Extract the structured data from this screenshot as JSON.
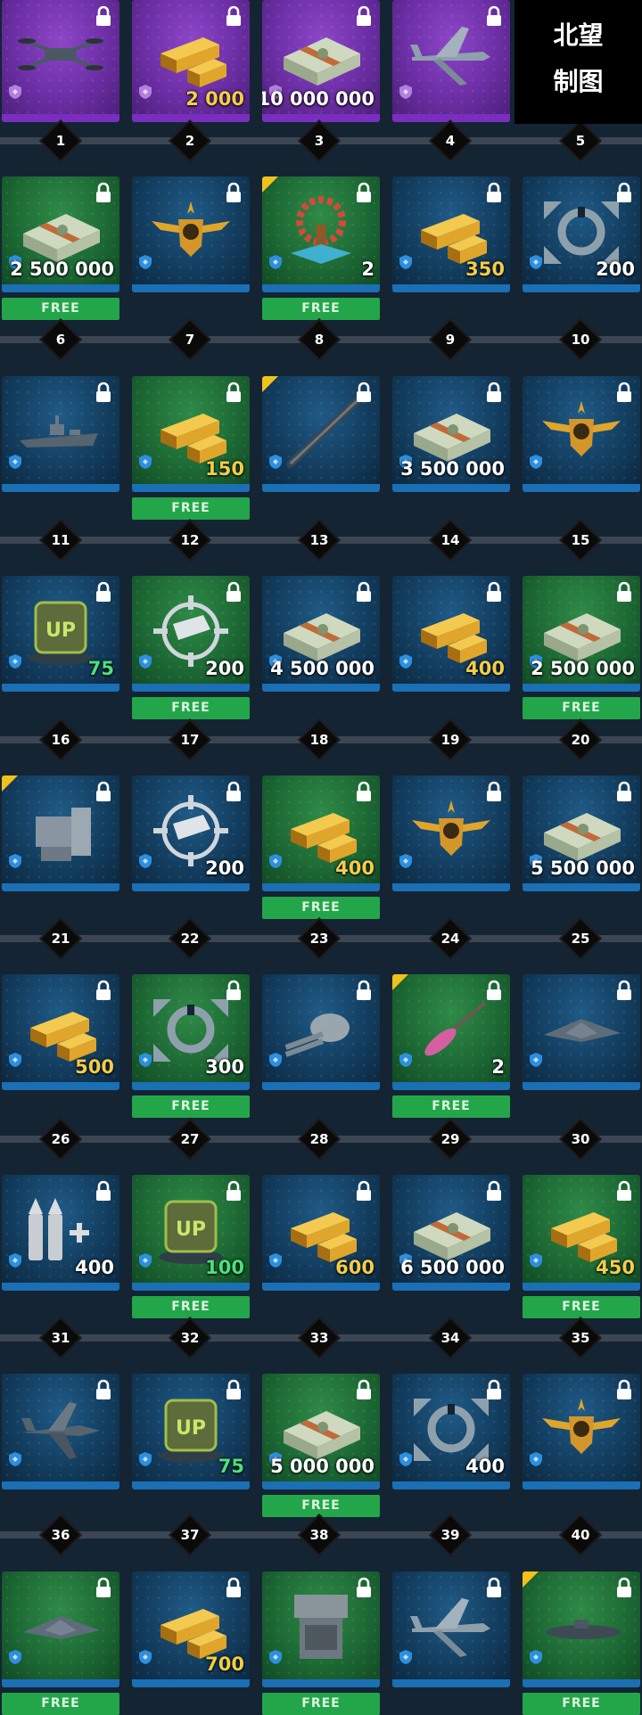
{
  "watermark": {
    "line1": "北望",
    "line2": "制图"
  },
  "colors": {
    "gold": "#f1cd4a",
    "free": "#23a64a",
    "blue_bar": "#1a6fb5",
    "premium": "#8c46c8",
    "rare_corner": "#f2c21b"
  },
  "free_label": "FREE",
  "levels": [
    "1",
    "2",
    "3",
    "4",
    "5",
    "6",
    "7",
    "8",
    "9",
    "10",
    "11",
    "12",
    "13",
    "14",
    "15",
    "16",
    "17",
    "18",
    "19",
    "20",
    "21",
    "22",
    "23",
    "24",
    "25",
    "26",
    "27",
    "28",
    "29",
    "30",
    "31",
    "32",
    "33",
    "34",
    "35",
    "36",
    "37",
    "38",
    "39",
    "40"
  ],
  "rows": [
    {
      "tiles": [
        {
          "style": "purple",
          "icon": "drone-icon",
          "amount": "",
          "amount_color": "white",
          "free": false,
          "corner": false
        },
        {
          "style": "purple",
          "icon": "gold-bars-icon",
          "amount": "2 000",
          "amount_color": "gold",
          "free": false,
          "corner": false
        },
        {
          "style": "purple",
          "icon": "cash-stack-icon",
          "amount": "10 000 000",
          "amount_color": "white",
          "free": false,
          "corner": false
        },
        {
          "style": "purple",
          "icon": "attack-plane-icon",
          "amount": "",
          "amount_color": "white",
          "free": false,
          "corner": false
        }
      ]
    },
    {
      "tiles": [
        {
          "style": "green",
          "icon": "cash-stack-icon",
          "amount": "2 500 000",
          "amount_color": "white",
          "free": true,
          "corner": false
        },
        {
          "style": "blue",
          "icon": "winged-emblem-icon",
          "amount": "",
          "amount_color": "white",
          "free": false,
          "corner": false
        },
        {
          "style": "green",
          "icon": "decoration-arch-icon",
          "amount": "2",
          "amount_color": "white",
          "free": true,
          "corner": true
        },
        {
          "style": "blue",
          "icon": "gold-bars-icon",
          "amount": "350",
          "amount_color": "gold",
          "free": false,
          "corner": false
        },
        {
          "style": "blue",
          "icon": "repair-kit-icon",
          "amount": "200",
          "amount_color": "white",
          "free": false,
          "corner": false
        }
      ]
    },
    {
      "tiles": [
        {
          "style": "blue",
          "icon": "warship-icon",
          "amount": "",
          "amount_color": "white",
          "free": false,
          "corner": false
        },
        {
          "style": "green",
          "icon": "gold-bars-icon",
          "amount": "150",
          "amount_color": "gold",
          "free": true,
          "corner": false
        },
        {
          "style": "blue",
          "icon": "rocket-launcher-icon",
          "amount": "",
          "amount_color": "white",
          "free": false,
          "corner": true
        },
        {
          "style": "blue",
          "icon": "cash-stack-icon",
          "amount": "3 500 000",
          "amount_color": "white",
          "free": false,
          "corner": false
        },
        {
          "style": "blue",
          "icon": "winged-emblem-icon",
          "amount": "",
          "amount_color": "white",
          "free": false,
          "corner": false
        }
      ]
    },
    {
      "tiles": [
        {
          "style": "blue",
          "icon": "upgrade-crate-icon",
          "amount": "75",
          "amount_color": "green",
          "free": false,
          "corner": false
        },
        {
          "style": "green",
          "icon": "crosshair-shell-icon",
          "amount": "200",
          "amount_color": "white",
          "free": true,
          "corner": false
        },
        {
          "style": "blue",
          "icon": "cash-stack-icon",
          "amount": "4 500 000",
          "amount_color": "white",
          "free": false,
          "corner": false
        },
        {
          "style": "blue",
          "icon": "gold-bars-icon",
          "amount": "400",
          "amount_color": "gold",
          "free": false,
          "corner": false
        },
        {
          "style": "green",
          "icon": "cash-stack-icon",
          "amount": "2 500 000",
          "amount_color": "white",
          "free": true,
          "corner": false
        }
      ]
    },
    {
      "tiles": [
        {
          "style": "blue",
          "icon": "missile-turret-icon",
          "amount": "",
          "amount_color": "white",
          "free": false,
          "corner": true
        },
        {
          "style": "blue",
          "icon": "crosshair-shell-icon",
          "amount": "200",
          "amount_color": "white",
          "free": false,
          "corner": false
        },
        {
          "style": "green",
          "icon": "gold-bars-icon",
          "amount": "400",
          "amount_color": "gold",
          "free": true,
          "corner": false
        },
        {
          "style": "blue",
          "icon": "winged-emblem-icon",
          "amount": "",
          "amount_color": "white",
          "free": false,
          "corner": false
        },
        {
          "style": "blue",
          "icon": "cash-stack-icon",
          "amount": "5 500 000",
          "amount_color": "white",
          "free": false,
          "corner": false
        }
      ]
    },
    {
      "tiles": [
        {
          "style": "blue",
          "icon": "gold-bars-icon",
          "amount": "500",
          "amount_color": "gold",
          "free": false,
          "corner": false
        },
        {
          "style": "green",
          "icon": "repair-kit-icon",
          "amount": "300",
          "amount_color": "white",
          "free": true,
          "corner": false
        },
        {
          "style": "blue",
          "icon": "gun-turret-icon",
          "amount": "",
          "amount_color": "white",
          "free": false,
          "corner": false
        },
        {
          "style": "green",
          "icon": "torpedo-icon",
          "amount": "2",
          "amount_color": "white",
          "free": true,
          "corner": true
        },
        {
          "style": "blue",
          "icon": "stealth-drone-icon",
          "amount": "",
          "amount_color": "white",
          "free": false,
          "corner": false
        }
      ]
    },
    {
      "tiles": [
        {
          "style": "blue",
          "icon": "ammo-plus-icon",
          "amount": "400",
          "amount_color": "white",
          "free": false,
          "corner": false
        },
        {
          "style": "green",
          "icon": "upgrade-crate-icon",
          "amount": "100",
          "amount_color": "green",
          "free": true,
          "corner": false
        },
        {
          "style": "blue",
          "icon": "gold-bars-icon",
          "amount": "600",
          "amount_color": "gold",
          "free": false,
          "corner": false
        },
        {
          "style": "blue",
          "icon": "cash-stack-icon",
          "amount": "6 500 000",
          "amount_color": "white",
          "free": false,
          "corner": false
        },
        {
          "style": "green",
          "icon": "gold-bars-icon",
          "amount": "450",
          "amount_color": "gold",
          "free": true,
          "corner": false
        }
      ]
    },
    {
      "tiles": [
        {
          "style": "blue",
          "icon": "fighter-jet-icon",
          "amount": "",
          "amount_color": "white",
          "free": false,
          "corner": false
        },
        {
          "style": "blue",
          "icon": "upgrade-crate-icon",
          "amount": "75",
          "amount_color": "green",
          "free": false,
          "corner": false
        },
        {
          "style": "green",
          "icon": "cash-stack-icon",
          "amount": "5 000 000",
          "amount_color": "white",
          "free": true,
          "corner": false
        },
        {
          "style": "blue",
          "icon": "repair-kit-icon",
          "amount": "400",
          "amount_color": "white",
          "free": false,
          "corner": false
        },
        {
          "style": "blue",
          "icon": "winged-emblem-icon",
          "amount": "",
          "amount_color": "white",
          "free": false,
          "corner": false
        }
      ]
    },
    {
      "tiles": [
        {
          "style": "green",
          "icon": "stealth-jet-icon",
          "amount": "",
          "amount_color": "white",
          "free": true,
          "corner": false
        },
        {
          "style": "blue",
          "icon": "gold-bars-icon",
          "amount": "700",
          "amount_color": "gold",
          "free": false,
          "corner": false
        },
        {
          "style": "green",
          "icon": "launcher-box-icon",
          "amount": "",
          "amount_color": "white",
          "free": true,
          "corner": false
        },
        {
          "style": "blue",
          "icon": "attack-plane-icon",
          "amount": "",
          "amount_color": "white",
          "free": false,
          "corner": false
        },
        {
          "style": "green",
          "icon": "submarine-icon",
          "amount": "",
          "amount_color": "white",
          "free": true,
          "corner": true
        }
      ]
    }
  ]
}
